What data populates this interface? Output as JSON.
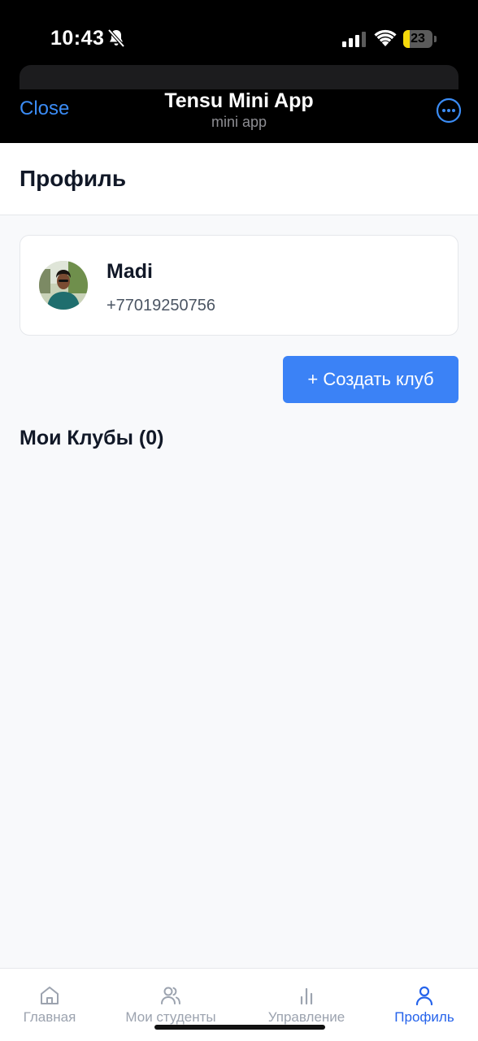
{
  "status_bar": {
    "time": "10:43",
    "battery_level": "23",
    "battery_fraction": 0.23
  },
  "mini_app_header": {
    "close_label": "Close",
    "title": "Tensu Mini App",
    "subtitle": "mini app",
    "more_icon": "more-horizontal-icon"
  },
  "page": {
    "title": "Профиль"
  },
  "profile": {
    "name": "Madi",
    "phone": "+77019250756"
  },
  "actions": {
    "create_club_label": "+ Создать клуб"
  },
  "clubs": {
    "title": "Мои Клубы (0)"
  },
  "bottom_nav": {
    "items": [
      {
        "label": "Главная",
        "icon": "home-icon",
        "active": false
      },
      {
        "label": "Мои студенты",
        "icon": "users-icon",
        "active": false
      },
      {
        "label": "Управление",
        "icon": "bar-chart-icon",
        "active": false
      },
      {
        "label": "Профиль",
        "icon": "user-icon",
        "active": true
      }
    ]
  },
  "colors": {
    "accent": "#3b82f6",
    "active_nav": "#2563eb",
    "telegram_link": "#3b8cf5",
    "battery_low": "#f5d90a"
  }
}
